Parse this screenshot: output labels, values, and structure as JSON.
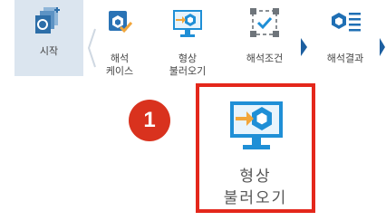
{
  "ribbon": {
    "tabs": [
      {
        "id": "start",
        "label_line1": "시작",
        "label_line2": ""
      },
      {
        "id": "analysis-case",
        "label_line1": "해석",
        "label_line2": "케이스"
      },
      {
        "id": "load-shape",
        "label_line1": "형상",
        "label_line2": "불러오기"
      },
      {
        "id": "analysis-condition",
        "label_line1": "해석조건",
        "label_line2": ""
      },
      {
        "id": "analysis-result",
        "label_line1": "해석결과",
        "label_line2": ""
      }
    ]
  },
  "callout": {
    "number": "1",
    "label_line1": "형상",
    "label_line2": "불러오기"
  },
  "colors": {
    "accent_blue": "#1f8fd6",
    "highlight_red": "#e4271b",
    "badge_red": "#d9321e",
    "arrow_orange": "#f2a63a",
    "selected_tab_bg": "#dbe5ef"
  },
  "icons": {
    "start": "grid-stack-icon",
    "analysis-case": "cube-check-icon",
    "load-shape": "monitor-import-icon",
    "analysis-condition": "condition-frame-icon",
    "analysis-result": "result-list-icon"
  }
}
